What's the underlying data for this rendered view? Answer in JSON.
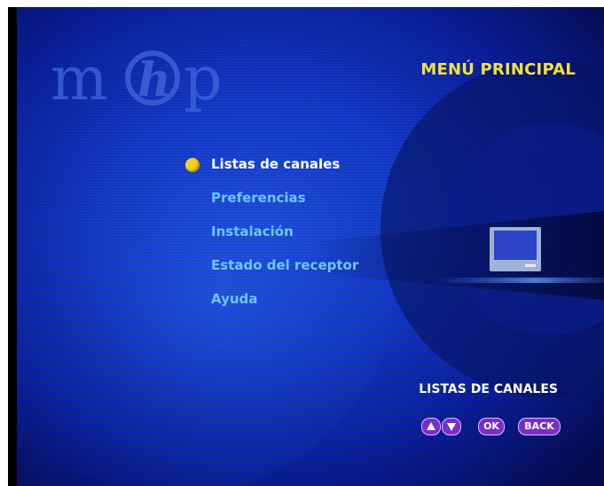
{
  "header": {
    "logo_text": "mhp",
    "title": "MENÚ PRINCIPAL"
  },
  "menu": {
    "items": [
      {
        "label": "Listas de canales",
        "selected": true
      },
      {
        "label": "Preferencias",
        "selected": false
      },
      {
        "label": "Instalación",
        "selected": false
      },
      {
        "label": "Estado del receptor",
        "selected": false
      },
      {
        "label": "Ayuda",
        "selected": false
      }
    ]
  },
  "footer": {
    "hint": "LISTAS DE CANALES",
    "buttons": {
      "up": "up-arrow-icon",
      "down": "down-arrow-icon",
      "ok": "OK",
      "back": "BACK"
    }
  },
  "colors": {
    "background": "#0b1f9e",
    "title": "#f2e338",
    "menu_text": "#6bc7ff",
    "selected_text": "#ffffff",
    "bullet": "#f4d21a",
    "button": "#7a2ec8"
  }
}
